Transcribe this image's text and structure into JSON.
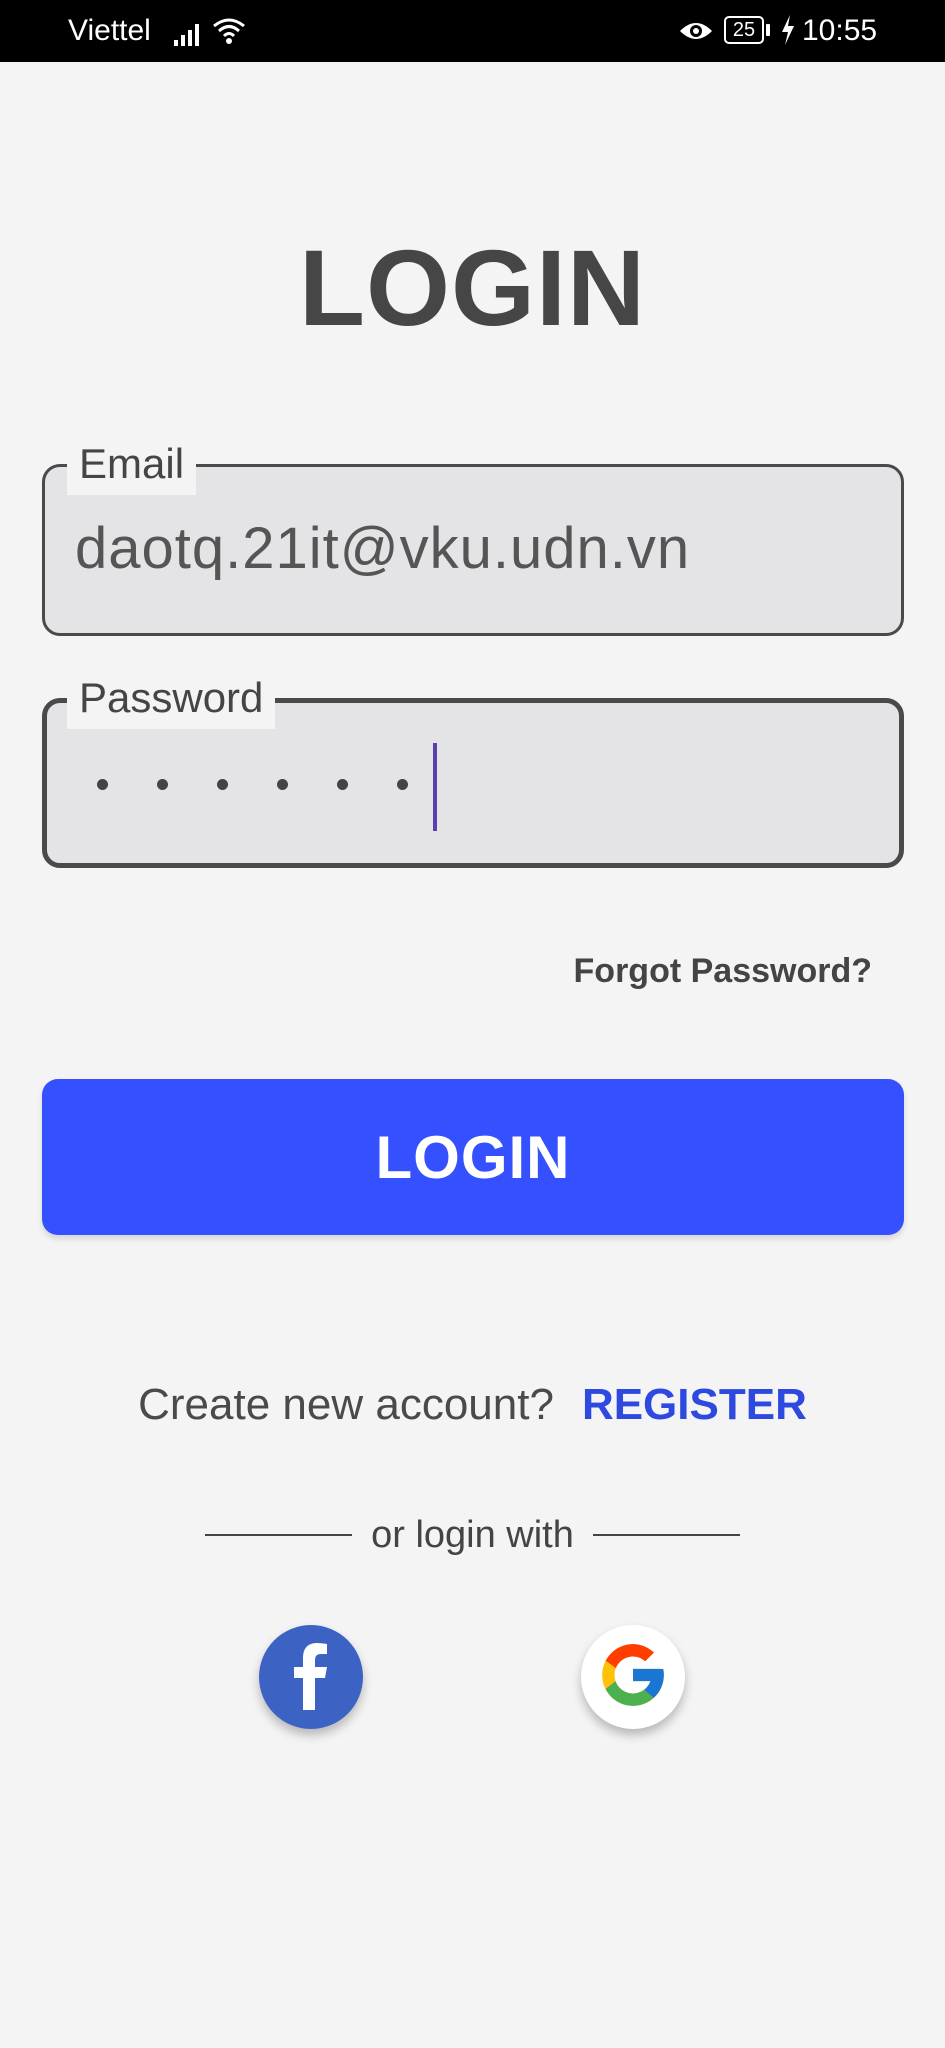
{
  "status_bar": {
    "carrier": "Viettel",
    "battery": "25",
    "time": "10:55"
  },
  "title": "LOGIN",
  "email": {
    "label": "Email",
    "value": "daotq.21it@vku.udn.vn"
  },
  "password": {
    "label": "Password",
    "masked_length": 6
  },
  "forgot_password": "Forgot Password?",
  "login_button": "LOGIN",
  "register": {
    "prompt": "Create new account?",
    "link": "REGISTER"
  },
  "divider_text": "or login with",
  "social": {
    "facebook_icon": "facebook-icon",
    "google_icon": "google-icon"
  },
  "colors": {
    "primary": "#3550ff",
    "link": "#2d49e0",
    "facebook": "#3c63c4"
  }
}
